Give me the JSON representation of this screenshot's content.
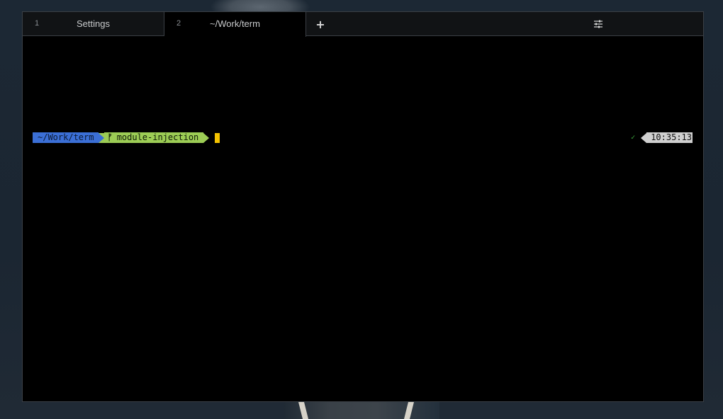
{
  "tabs": [
    {
      "number": "1",
      "title": "Settings",
      "active": false
    },
    {
      "number": "2",
      "title": "~/Work/term",
      "active": true
    }
  ],
  "new_tab_label": "+",
  "icons": {
    "new_tab": "plus-icon",
    "settings": "sliders-icon",
    "branch": "git-branch-icon",
    "status_ok": "check-icon"
  },
  "prompt": {
    "directory": "~/Work/term",
    "branch_glyph": "ⓕ",
    "branch": "module-injection",
    "status": "✓",
    "time": "10:35:13"
  },
  "colors": {
    "dir_segment": "#3b6fd6",
    "git_segment": "#9ccc55",
    "cursor": "#f5c300",
    "time_segment": "#d0d0d0",
    "status_ok": "#40b040"
  }
}
